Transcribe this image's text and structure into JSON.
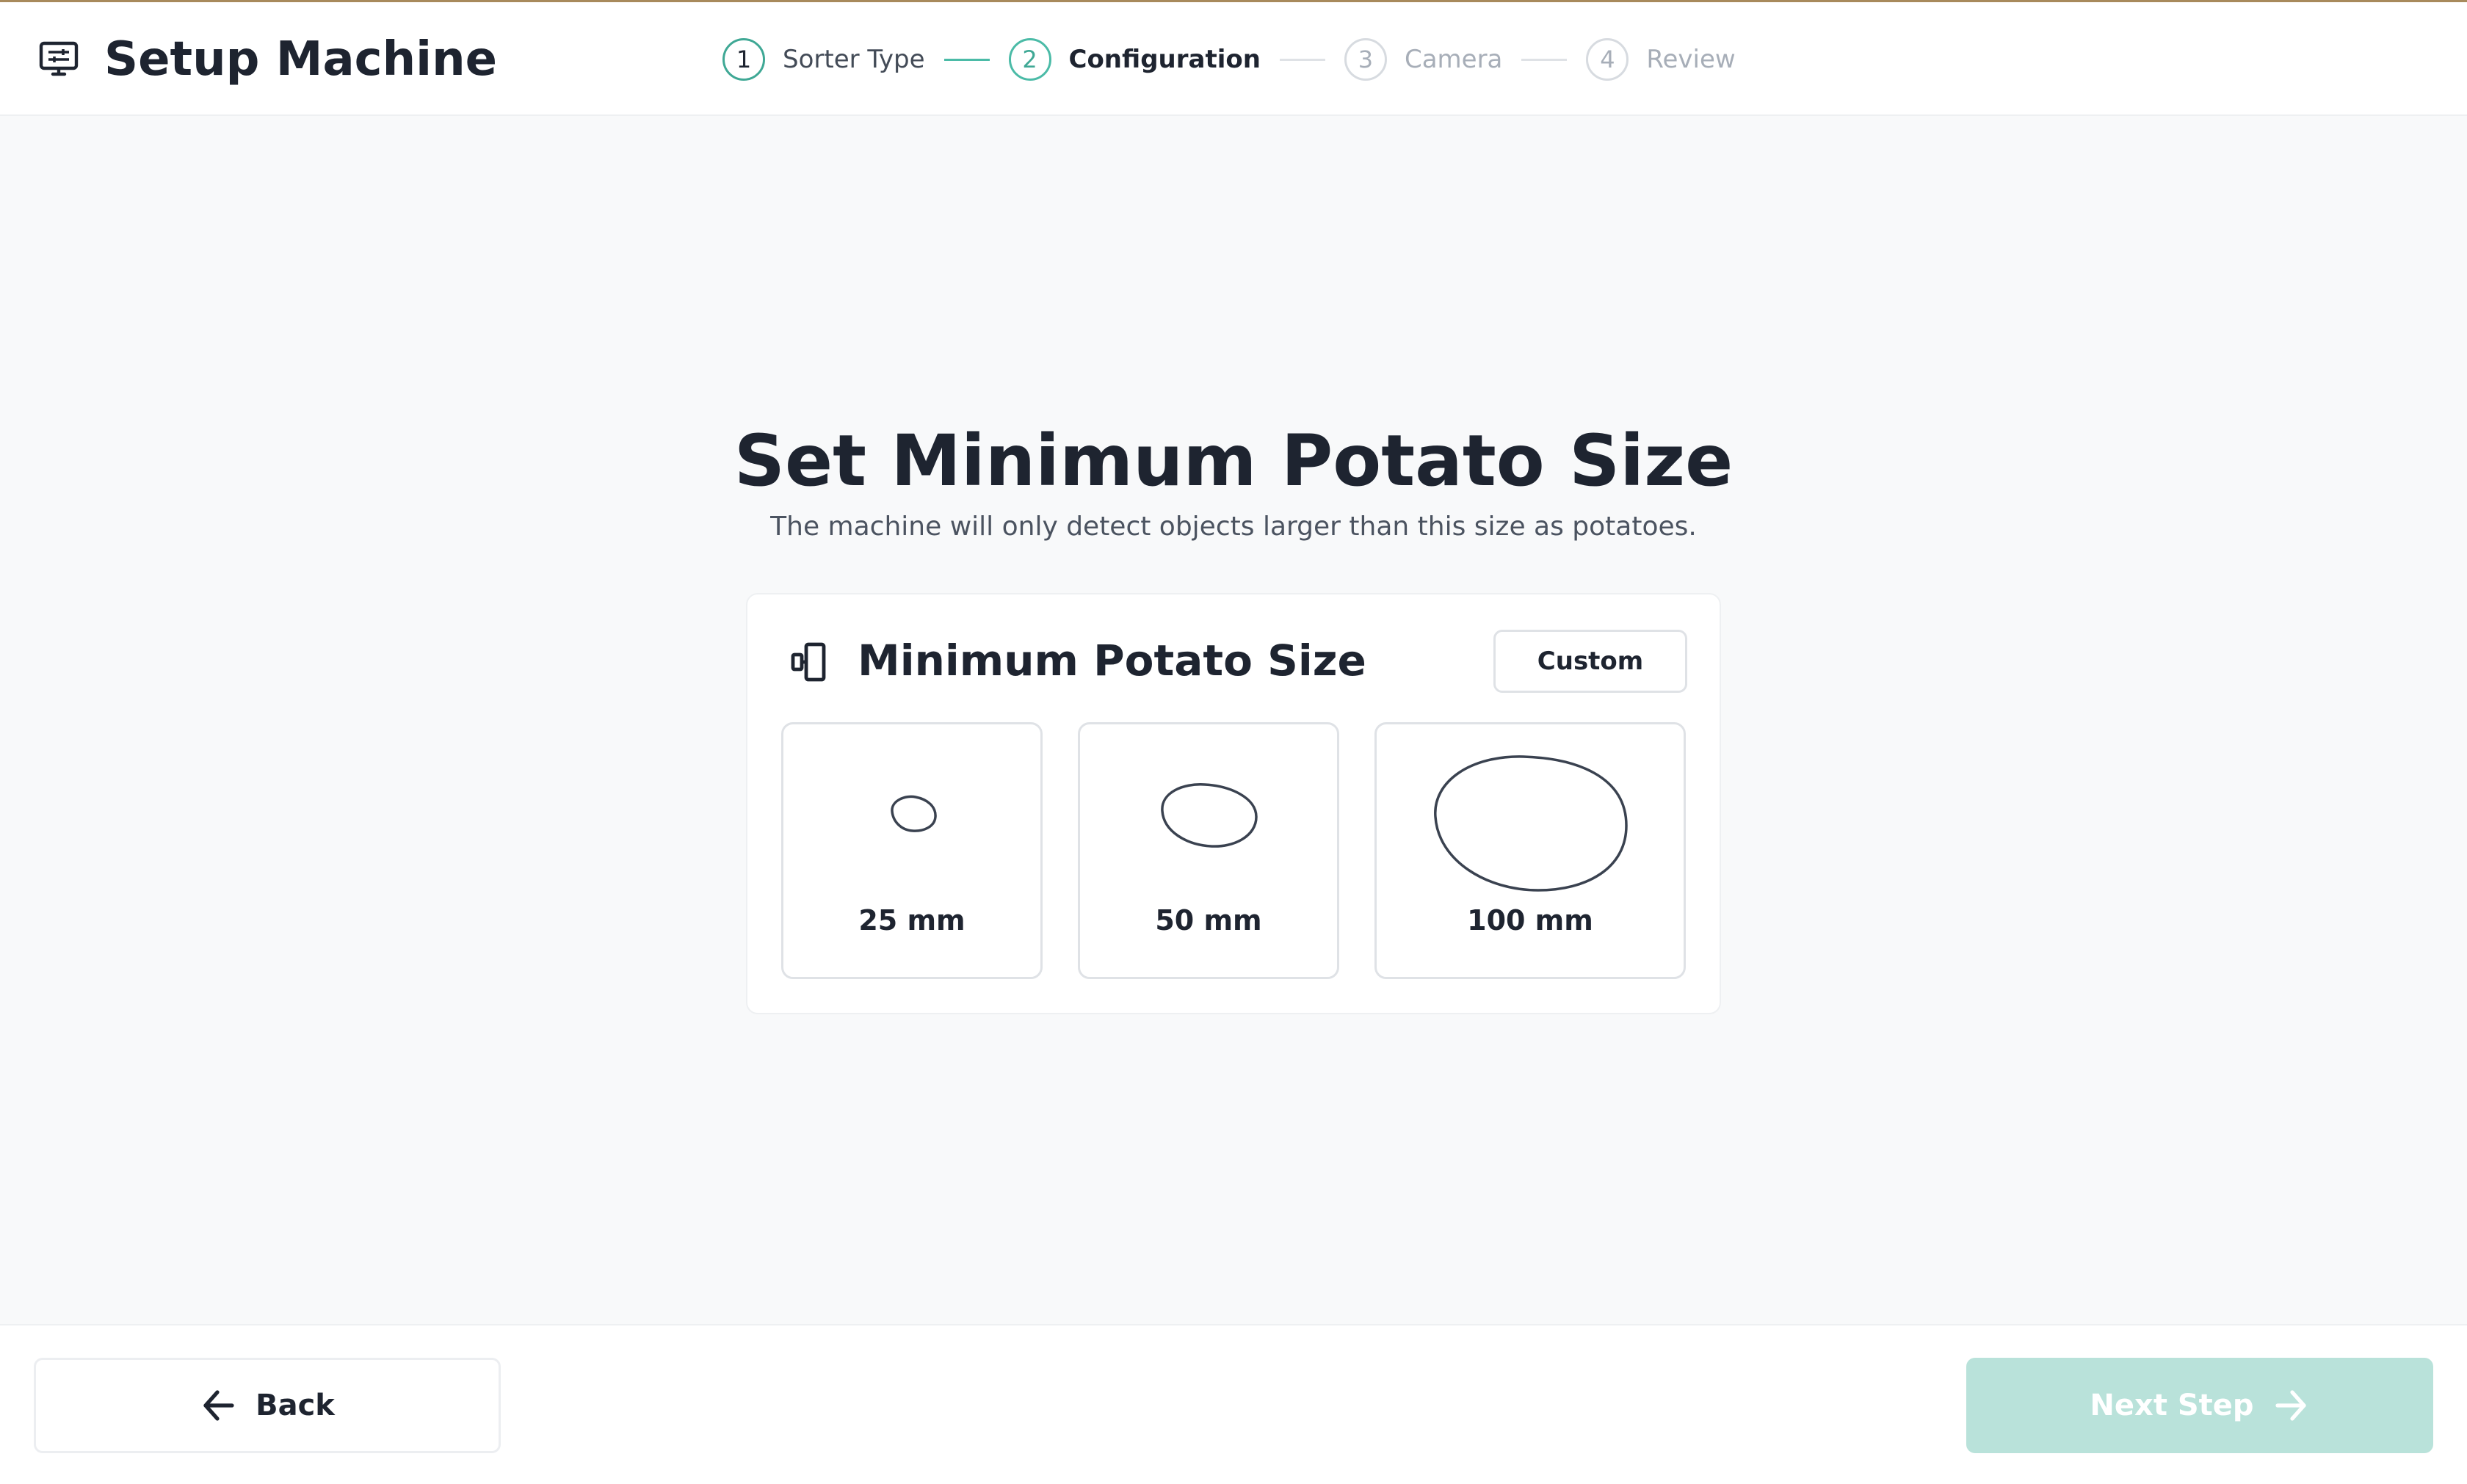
{
  "header": {
    "title": "Setup Machine",
    "icon": "monitor-settings-icon"
  },
  "stepper": {
    "steps": [
      {
        "number": "1",
        "label": "Sorter Type",
        "state": "done"
      },
      {
        "number": "2",
        "label": "Configuration",
        "state": "active"
      },
      {
        "number": "3",
        "label": "Camera",
        "state": "todo"
      },
      {
        "number": "4",
        "label": "Review",
        "state": "todo"
      }
    ]
  },
  "main": {
    "title": "Set Minimum Potato Size",
    "subtitle": "The machine will only detect objects larger than this size as potatoes."
  },
  "card": {
    "icon": "size-compare-icon",
    "title": "Minimum Potato Size",
    "custom_label": "Custom",
    "options": [
      {
        "label": "25 mm",
        "value_mm": 25
      },
      {
        "label": "50 mm",
        "value_mm": 50
      },
      {
        "label": "100 mm",
        "value_mm": 100
      }
    ]
  },
  "footer": {
    "back_label": "Back",
    "back_icon": "arrow-left-icon",
    "next_label": "Next Step",
    "next_icon": "arrow-right-icon",
    "next_enabled": false
  },
  "colors": {
    "accent": "#4bbba7",
    "accent_disabled": "#b9e2da",
    "top_border": "#a88a5c",
    "text_dark": "#1e2430",
    "text_muted": "#a7aeb8"
  }
}
